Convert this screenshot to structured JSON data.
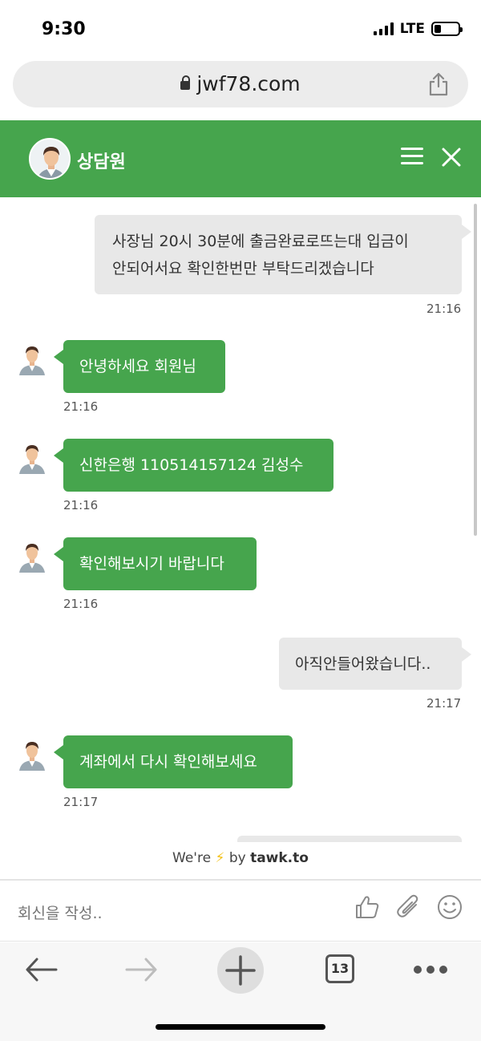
{
  "status_bar": {
    "time": "9:30",
    "network": "LTE"
  },
  "browser": {
    "url": "jwf78.com",
    "tabs_count": "13"
  },
  "chat_header": {
    "agent_name": "상담원"
  },
  "messages": [
    {
      "from": "visitor",
      "lines": [
        "사장님 20시 30분에 출금완료로뜨는대 입금이",
        "안되어서요 확인한번만 부탁드리겠습니다"
      ],
      "time": "21:16"
    },
    {
      "from": "agent",
      "lines": [
        "안녕하세요 회원님"
      ],
      "time": "21:16"
    },
    {
      "from": "agent",
      "lines": [
        "신한은행 110514157124 김성수"
      ],
      "time": "21:16"
    },
    {
      "from": "agent",
      "lines": [
        "확인해보시기 바랍니다"
      ],
      "time": "21:16"
    },
    {
      "from": "visitor",
      "lines": [
        "아직안들어왔습니다.."
      ],
      "time": "21:17"
    },
    {
      "from": "agent",
      "lines": [
        "계좌에서 다시 확인해보세요"
      ],
      "time": "21:17"
    }
  ],
  "branding": {
    "prefix": "We're",
    "bolt": "⚡",
    "by": "by",
    "brand": "tawk.to"
  },
  "compose": {
    "placeholder": "회신을 작성.."
  },
  "colors": {
    "accent": "#46a54d",
    "visitor_bubble": "#e8e8e8"
  },
  "icons": [
    "lock-icon",
    "share-icon",
    "menu-icon",
    "close-icon",
    "thumbs-up-icon",
    "paperclip-icon",
    "smiley-icon",
    "back-arrow-icon",
    "forward-arrow-icon",
    "plus-icon",
    "more-icon"
  ]
}
